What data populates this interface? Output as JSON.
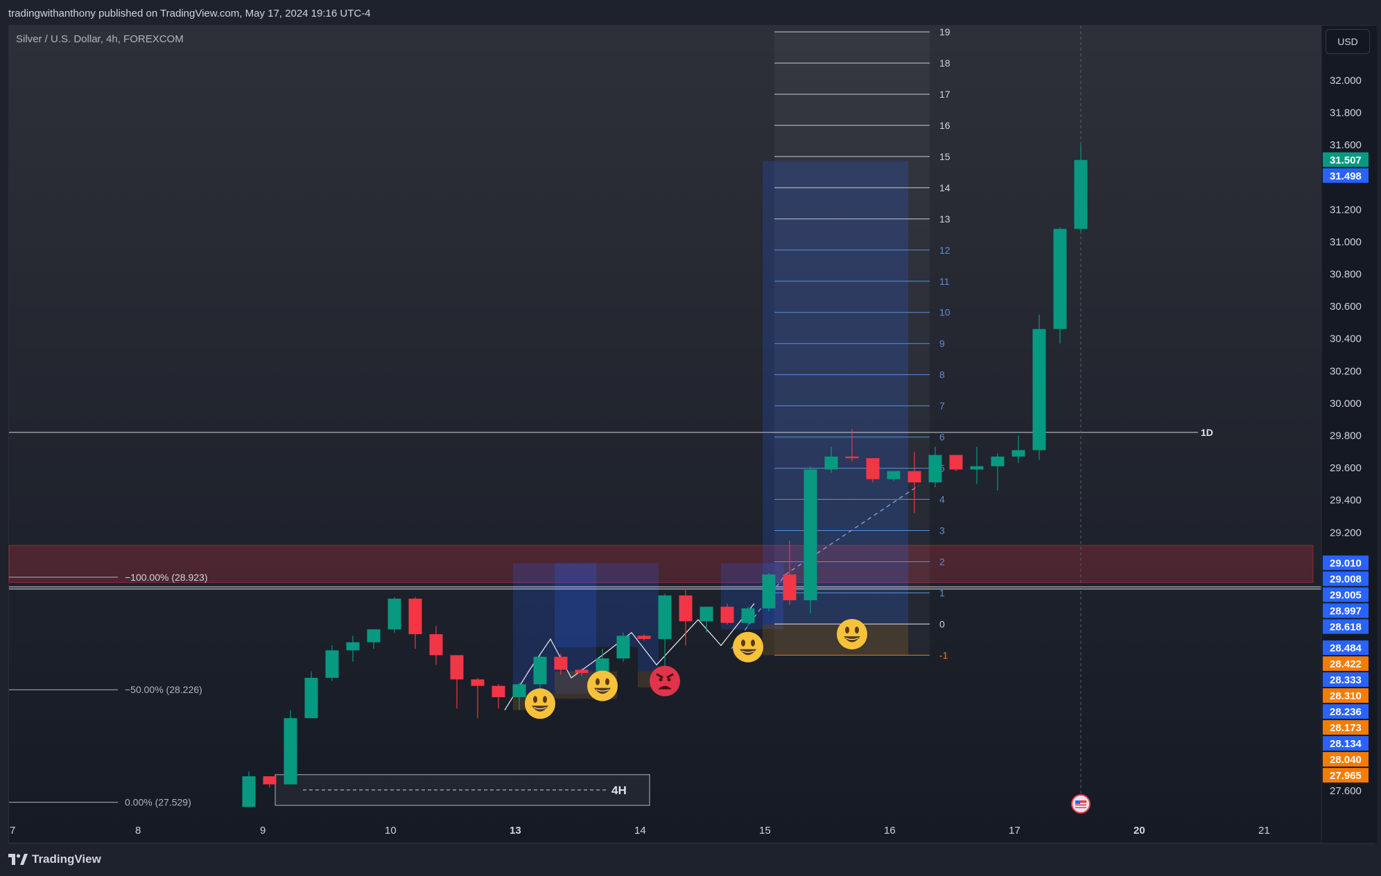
{
  "header": {
    "published_line": "tradingwithanthony published on TradingView.com, May 17, 2024 19:16 UTC-4"
  },
  "symbol": "Silver / U.S. Dollar, 4h, FOREXCOM",
  "currency": "USD",
  "brand": "TradingView",
  "colors": {
    "background": "#181c27",
    "bull": "#089981",
    "bear": "#f23645",
    "accent_blue": "#2962ff",
    "accent_orange": "#f57c00",
    "resistance_zone": "#f23645"
  },
  "chart_data": {
    "type": "candlestick",
    "symbol": "Silver / U.S. Dollar",
    "interval": "4h",
    "exchange": "FOREXCOM",
    "ylim": [
      27.48,
      32.3
    ],
    "price_ticks": [
      32.0,
      31.8,
      31.6,
      31.2,
      31.0,
      30.8,
      30.6,
      30.4,
      30.2,
      30.0,
      29.8,
      29.6,
      29.4,
      29.2,
      27.6
    ],
    "x_ticks": [
      {
        "label": "7",
        "t": 0
      },
      {
        "label": "8",
        "t": 6
      },
      {
        "label": "9",
        "t": 12
      },
      {
        "label": "10",
        "t": 18
      },
      {
        "label": "13",
        "t": 24,
        "bold": true
      },
      {
        "label": "14",
        "t": 30
      },
      {
        "label": "15",
        "t": 36
      },
      {
        "label": "16",
        "t": 42
      },
      {
        "label": "17",
        "t": 48
      },
      {
        "label": "20",
        "t": 54,
        "bold": true
      },
      {
        "label": "21",
        "t": 60
      }
    ],
    "candles": [
      {
        "t": 11,
        "o": 27.5,
        "h": 27.72,
        "l": 27.5,
        "c": 27.69
      },
      {
        "t": 12,
        "o": 27.69,
        "h": 27.69,
        "l": 27.62,
        "c": 27.64
      },
      {
        "t": 13,
        "o": 27.64,
        "h": 28.1,
        "l": 27.64,
        "c": 28.05
      },
      {
        "t": 14,
        "o": 28.05,
        "h": 28.34,
        "l": 28.05,
        "c": 28.3
      },
      {
        "t": 15,
        "o": 28.3,
        "h": 28.5,
        "l": 28.28,
        "c": 28.47
      },
      {
        "t": 16,
        "o": 28.47,
        "h": 28.56,
        "l": 28.4,
        "c": 28.52
      },
      {
        "t": 17,
        "o": 28.52,
        "h": 28.6,
        "l": 28.48,
        "c": 28.6
      },
      {
        "t": 18,
        "o": 28.6,
        "h": 28.8,
        "l": 28.58,
        "c": 28.79
      },
      {
        "t": 19,
        "o": 28.79,
        "h": 28.8,
        "l": 28.48,
        "c": 28.57
      },
      {
        "t": 20,
        "o": 28.57,
        "h": 28.62,
        "l": 28.38,
        "c": 28.44
      },
      {
        "t": 21,
        "o": 28.44,
        "h": 28.44,
        "l": 28.11,
        "c": 28.29
      },
      {
        "t": 22,
        "o": 28.29,
        "h": 28.3,
        "l": 28.05,
        "c": 28.25
      },
      {
        "t": 23,
        "o": 28.25,
        "h": 28.26,
        "l": 28.11,
        "c": 28.18
      },
      {
        "t": 24,
        "o": 28.18,
        "h": 28.27,
        "l": 28.1,
        "c": 28.26
      },
      {
        "t": 25,
        "o": 28.26,
        "h": 28.44,
        "l": 28.21,
        "c": 28.43
      },
      {
        "t": 26,
        "o": 28.43,
        "h": 28.45,
        "l": 28.32,
        "c": 28.35
      },
      {
        "t": 27,
        "o": 28.35,
        "h": 28.36,
        "l": 28.31,
        "c": 28.33
      },
      {
        "t": 28,
        "o": 28.33,
        "h": 28.48,
        "l": 28.3,
        "c": 28.42
      },
      {
        "t": 29,
        "o": 28.42,
        "h": 28.58,
        "l": 28.4,
        "c": 28.56
      },
      {
        "t": 30,
        "o": 28.56,
        "h": 28.57,
        "l": 28.53,
        "c": 28.54
      },
      {
        "t": 31,
        "o": 28.54,
        "h": 28.82,
        "l": 28.2,
        "c": 28.81
      },
      {
        "t": 32,
        "o": 28.81,
        "h": 28.85,
        "l": 28.5,
        "c": 28.65
      },
      {
        "t": 33,
        "o": 28.65,
        "h": 28.74,
        "l": 28.58,
        "c": 28.74
      },
      {
        "t": 34,
        "o": 28.74,
        "h": 28.76,
        "l": 28.63,
        "c": 28.64
      },
      {
        "t": 35,
        "o": 28.64,
        "h": 28.74,
        "l": 28.62,
        "c": 28.73
      },
      {
        "t": 36,
        "o": 28.73,
        "h": 28.95,
        "l": 28.71,
        "c": 28.94
      },
      {
        "t": 37,
        "o": 28.94,
        "h": 29.15,
        "l": 28.75,
        "c": 28.78
      },
      {
        "t": 38,
        "o": 28.78,
        "h": 29.61,
        "l": 28.7,
        "c": 29.59
      },
      {
        "t": 39,
        "o": 29.59,
        "h": 29.73,
        "l": 29.57,
        "c": 29.67
      },
      {
        "t": 40,
        "o": 29.67,
        "h": 29.84,
        "l": 29.64,
        "c": 29.66
      },
      {
        "t": 41,
        "o": 29.66,
        "h": 29.66,
        "l": 29.51,
        "c": 29.53
      },
      {
        "t": 42,
        "o": 29.53,
        "h": 29.58,
        "l": 29.52,
        "c": 29.58
      },
      {
        "t": 43,
        "o": 29.58,
        "h": 29.7,
        "l": 29.32,
        "c": 29.51
      },
      {
        "t": 44,
        "o": 29.51,
        "h": 29.73,
        "l": 29.48,
        "c": 29.68
      },
      {
        "t": 45,
        "o": 29.68,
        "h": 29.68,
        "l": 29.58,
        "c": 29.59
      },
      {
        "t": 46,
        "o": 29.59,
        "h": 29.73,
        "l": 29.5,
        "c": 29.61
      },
      {
        "t": 47,
        "o": 29.61,
        "h": 29.69,
        "l": 29.46,
        "c": 29.67
      },
      {
        "t": 48,
        "o": 29.67,
        "h": 29.8,
        "l": 29.63,
        "c": 29.71
      },
      {
        "t": 49,
        "o": 29.71,
        "h": 30.55,
        "l": 29.65,
        "c": 30.46
      },
      {
        "t": 50,
        "o": 30.46,
        "h": 31.09,
        "l": 30.37,
        "c": 31.08
      },
      {
        "t": 51,
        "o": 31.08,
        "h": 31.6,
        "l": 31.06,
        "c": 31.507
      }
    ],
    "price_labels": [
      {
        "text": "31.507",
        "price": 31.507,
        "color": "#089981"
      },
      {
        "text": "31.498",
        "price": 31.498,
        "color": "#2962ff"
      },
      {
        "text": "29.010",
        "price": 29.01,
        "color": "#2962ff"
      },
      {
        "text": "29.008",
        "price": 29.008,
        "color": "#2962ff"
      },
      {
        "text": "29.005",
        "price": 29.005,
        "color": "#2962ff"
      },
      {
        "text": "28.997",
        "price": 28.997,
        "color": "#2962ff"
      },
      {
        "text": "28.618",
        "price": 28.618,
        "color": "#2962ff"
      },
      {
        "text": "28.484",
        "price": 28.484,
        "color": "#2962ff"
      },
      {
        "text": "28.422",
        "price": 28.422,
        "color": "#f57c00"
      },
      {
        "text": "28.333",
        "price": 28.333,
        "color": "#2962ff"
      },
      {
        "text": "28.310",
        "price": 28.31,
        "color": "#f57c00"
      },
      {
        "text": "28.236",
        "price": 28.236,
        "color": "#2962ff"
      },
      {
        "text": "28.173",
        "price": 28.173,
        "color": "#f57c00"
      },
      {
        "text": "28.134",
        "price": 28.134,
        "color": "#2962ff"
      },
      {
        "text": "28.040",
        "price": 28.04,
        "color": "#f57c00"
      },
      {
        "text": "27.965",
        "price": 27.965,
        "color": "#f57c00"
      }
    ],
    "fib_levels": [
      {
        "label": "−100.00% (28.923)",
        "price": 28.923
      },
      {
        "label": "−50.00% (28.226)",
        "price": 28.226
      },
      {
        "label": "0.00% (27.529)",
        "price": 27.529
      }
    ],
    "resistance_zone": {
      "top": 29.12,
      "bottom": 28.89
    },
    "horizontal_line": {
      "label": "1D",
      "price": 29.82
    },
    "box_label": "4H",
    "box_4h": {
      "t_start": 12,
      "t_end": 30,
      "top": 27.7,
      "bottom": 27.51
    },
    "grid_levels": {
      "t_start": 36,
      "t_end": 44,
      "levels": [
        {
          "label": "19",
          "price": 32.3
        },
        {
          "label": "18",
          "price": 32.107
        },
        {
          "label": "17",
          "price": 31.914
        },
        {
          "label": "16",
          "price": 31.721
        },
        {
          "label": "15",
          "price": 31.528
        },
        {
          "label": "14",
          "price": 31.335
        },
        {
          "label": "13",
          "price": 31.142
        },
        {
          "label": "12",
          "price": 30.949
        },
        {
          "label": "11",
          "price": 30.756
        },
        {
          "label": "10",
          "price": 30.563
        },
        {
          "label": "9",
          "price": 30.37
        },
        {
          "label": "8",
          "price": 30.177
        },
        {
          "label": "7",
          "price": 29.984
        },
        {
          "label": "6",
          "price": 29.791
        },
        {
          "label": "5",
          "price": 29.598
        },
        {
          "label": "4",
          "price": 29.405
        },
        {
          "label": "3",
          "price": 29.212
        },
        {
          "label": "2",
          "price": 29.019
        },
        {
          "label": "1",
          "price": 28.826
        },
        {
          "label": "0",
          "price": 28.633
        },
        {
          "label": "-1",
          "price": 28.44
        }
      ]
    },
    "position_zones": [
      {
        "t_start": 24,
        "t_end": 28,
        "top": 29.01,
        "bottom": 28.2
      },
      {
        "t_start": 26,
        "t_end": 30,
        "top": 29.01,
        "bottom": 28.49
      },
      {
        "t_start": 30,
        "t_end": 31,
        "top": 29.01,
        "bottom": 28.34
      },
      {
        "t_start": 34,
        "t_end": 37,
        "top": 29.01,
        "bottom": 28.6
      },
      {
        "t_start": 36,
        "t_end": 43,
        "top": 31.5,
        "bottom": 28.63
      }
    ],
    "loss_zones": [
      {
        "t_start": 24,
        "t_end": 26,
        "top": 28.2,
        "bottom": 28.1
      },
      {
        "t_start": 26,
        "t_end": 29,
        "top": 28.34,
        "bottom": 28.17
      },
      {
        "t_start": 30,
        "t_end": 31,
        "top": 28.34,
        "bottom": 28.24
      },
      {
        "t_start": 36,
        "t_end": 43,
        "top": 28.63,
        "bottom": 28.44
      }
    ],
    "trend_path": [
      {
        "t": 23.3,
        "p": 28.1
      },
      {
        "t": 24.5,
        "p": 28.35
      },
      {
        "t": 25.5,
        "p": 28.54
      },
      {
        "t": 26.5,
        "p": 28.3
      },
      {
        "t": 28,
        "p": 28.44
      },
      {
        "t": 29.4,
        "p": 28.58
      },
      {
        "t": 30.6,
        "p": 28.38
      },
      {
        "t": 32.6,
        "p": 28.66
      },
      {
        "t": 33.7,
        "p": 28.5
      },
      {
        "t": 35.3,
        "p": 28.76
      }
    ],
    "dashed_path": [
      {
        "t": 34.2,
        "p": 28.48
      },
      {
        "t": 36.8,
        "p": 28.94
      },
      {
        "t": 43.2,
        "p": 29.49
      }
    ],
    "markers": [
      {
        "kind": "smile",
        "t": 25,
        "p": 28.14
      },
      {
        "kind": "smile",
        "t": 28,
        "p": 28.25
      },
      {
        "kind": "angry",
        "t": 31,
        "p": 28.28
      },
      {
        "kind": "smile",
        "t": 35,
        "p": 28.49
      },
      {
        "kind": "smile",
        "t": 40,
        "p": 28.57
      }
    ],
    "event_marker": {
      "t": 51,
      "icon": "us-flag-icon"
    },
    "current_time_t": 51
  }
}
